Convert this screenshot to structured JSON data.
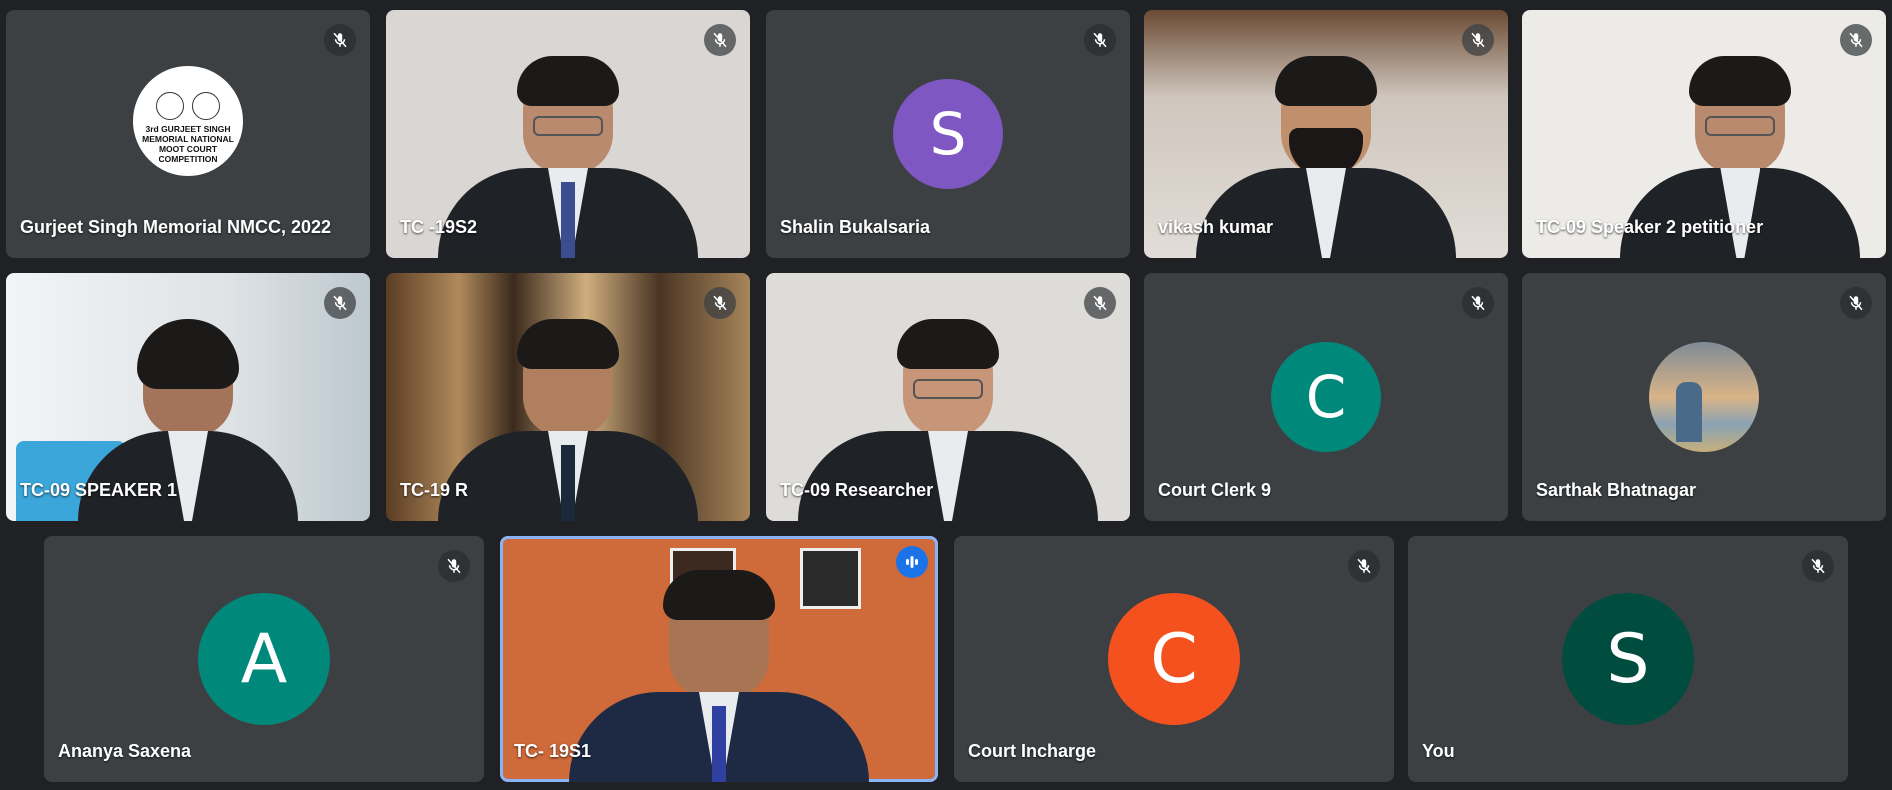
{
  "participants": [
    {
      "name": "Gurjeet Singh Memorial NMCC, 2022",
      "type": "logo",
      "logo_text": [
        "3rd GURJEET SINGH",
        "MEMORIAL NATIONAL",
        "MOOT COURT",
        "COMPETITION"
      ],
      "muted": true
    },
    {
      "name": "TC -19S2",
      "type": "video",
      "bg": "#d9d6d3",
      "muted": true
    },
    {
      "name": "Shalin Bukalsaria",
      "type": "avatar",
      "initial": "S",
      "color": "#7e57c2",
      "muted": true
    },
    {
      "name": "vikash kumar",
      "type": "video",
      "bg": "#cfc6bd",
      "muted": true
    },
    {
      "name": "TC-09 Speaker 2 petitioner",
      "type": "video",
      "bg": "#ecebe8",
      "muted": true
    },
    {
      "name": "TC-09 SPEAKER 1",
      "type": "video",
      "bg": "#e6e8ea",
      "muted": true
    },
    {
      "name": "TC-19 R",
      "type": "video",
      "bg": "#8e6a44",
      "muted": true
    },
    {
      "name": "TC-09 Researcher",
      "type": "video",
      "bg": "#dedcd9",
      "muted": true
    },
    {
      "name": "Court Clerk 9",
      "type": "avatar",
      "initial": "C",
      "color": "#00897b",
      "muted": true
    },
    {
      "name": "Sarthak Bhatnagar",
      "type": "photo",
      "color": "#c8b07a",
      "muted": true
    },
    {
      "name": "Ananya Saxena",
      "type": "avatar",
      "initial": "A",
      "color": "#00897b",
      "muted": true
    },
    {
      "name": "TC- 19S1",
      "type": "video",
      "bg": "#cf6a3a",
      "muted": false,
      "speaking": true
    },
    {
      "name": "Court Incharge",
      "type": "avatar",
      "initial": "C",
      "color": "#f4511e",
      "muted": true
    },
    {
      "name": "You",
      "type": "avatar",
      "initial": "S",
      "color": "#004d40",
      "muted": true
    }
  ],
  "icons": {
    "muted": "mic-off-icon",
    "speaking": "audio-level-icon"
  }
}
